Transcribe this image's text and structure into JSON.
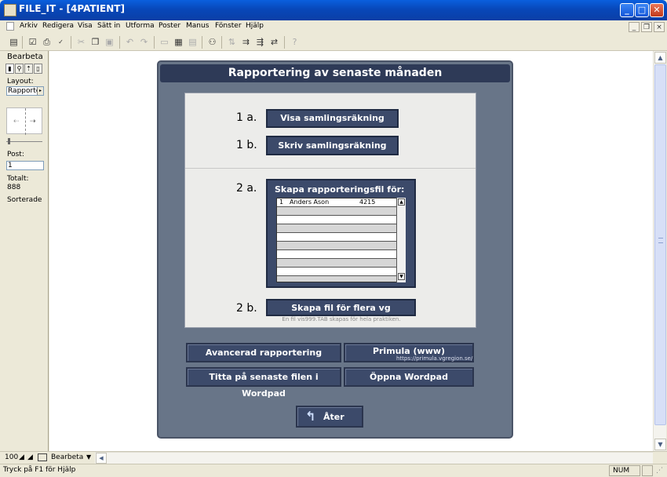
{
  "window": {
    "title": "FILE_IT - [4PATIENT]"
  },
  "menu": [
    "Arkiv",
    "Redigera",
    "Visa",
    "Sätt in",
    "Utforma",
    "Poster",
    "Manus",
    "Fönster",
    "Hjälp"
  ],
  "left_panel": {
    "mode": "Bearbeta",
    "layout_label": "Layout:",
    "layout_value": "Rapporte",
    "post_label": "Post:",
    "post_value": "1",
    "total_label": "Totalt:",
    "total_value": "888",
    "sorted": "Sorterade"
  },
  "panel": {
    "title": "Rapportering av senaste månaden",
    "step_1a": "1 a.",
    "btn_1a": "Visa samlingsräkning",
    "step_1b": "1 b.",
    "btn_1b": "Skriv samlingsräkning",
    "step_2a": "2 a.",
    "list_title": "Skapa rapporteringsfil för:",
    "list_rows": [
      {
        "num": "1",
        "name": "Anders Ason",
        "code": "4215"
      }
    ],
    "step_2b": "2 b.",
    "btn_2b": "Skapa fil för flera vg",
    "hint": "En fil vis999.TAB skapas för hela praktiken.",
    "btn_advanced": "Avancerad rapportering",
    "btn_primula": "Primula (www)",
    "primula_url": "https://primula.vgregion.se/",
    "btn_titta": "Titta på senaste filen i  Wordpad",
    "btn_oppna": "Öppna Wordpad",
    "btn_back": "Åter"
  },
  "bottom": {
    "zoom": "100",
    "mode": "Bearbeta"
  },
  "status": {
    "help": "Tryck på F1 för Hjälp",
    "num": "NUM"
  }
}
